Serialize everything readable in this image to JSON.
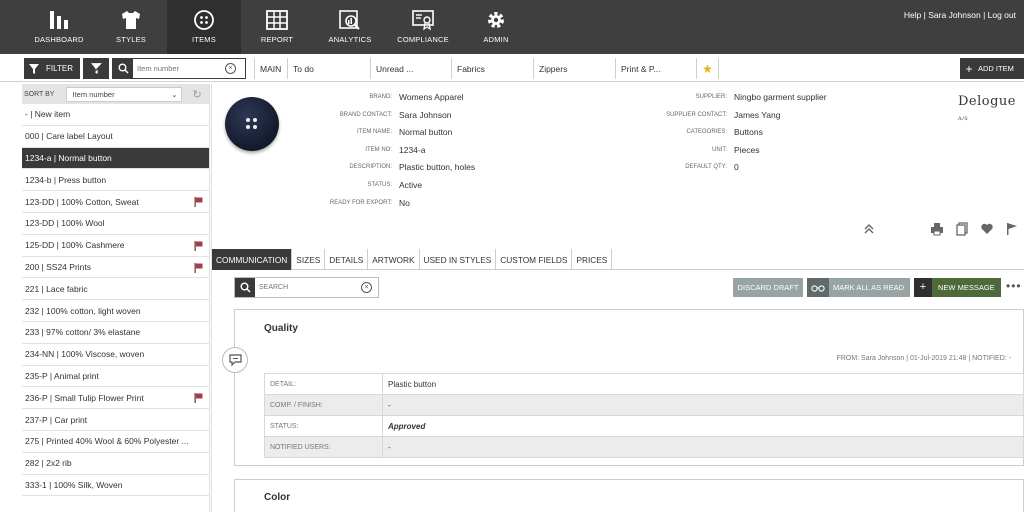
{
  "nav": {
    "items": [
      {
        "label": "DASHBOARD",
        "icon": "bar-chart-icon"
      },
      {
        "label": "STYLES",
        "icon": "shirt-icon"
      },
      {
        "label": "ITEMS",
        "icon": "button-icon"
      },
      {
        "label": "REPORT",
        "icon": "table-icon"
      },
      {
        "label": "ANALYTICS",
        "icon": "analytics-icon"
      },
      {
        "label": "COMPLIANCE",
        "icon": "certificate-icon"
      },
      {
        "label": "ADMIN",
        "icon": "gear-icon"
      }
    ],
    "active": "ITEMS",
    "user_links": "Help | Sara Johnson | Log out"
  },
  "toolbar": {
    "filter_label": "FILTER",
    "search_placeholder": "Item number",
    "tabs": [
      "MAIN",
      "To do",
      "Unread ...",
      "Fabrics",
      "Zippers",
      "Print & P..."
    ],
    "add_item_label": "ADD ITEM"
  },
  "sidebar": {
    "sort_by_label": "SORT BY",
    "sort_value": "Item number",
    "items": [
      {
        "label": "- | New item",
        "flag": false
      },
      {
        "label": "000 | Care label Layout",
        "flag": false
      },
      {
        "label": "1234-a | Normal button",
        "flag": false,
        "selected": true
      },
      {
        "label": "1234-b | Press button",
        "flag": false
      },
      {
        "label": "123-DD | 100% Cotton, Sweat",
        "flag": true
      },
      {
        "label": "123-DD | 100% Wool",
        "flag": false
      },
      {
        "label": "125-DD | 100% Cashmere",
        "flag": true
      },
      {
        "label": "200 | SS24 Prints",
        "flag": true
      },
      {
        "label": "221 | Lace fabric",
        "flag": false
      },
      {
        "label": "232 | 100% cotton, light woven",
        "flag": false
      },
      {
        "label": "233 | 97% cotton/ 3% elastane",
        "flag": false
      },
      {
        "label": "234-NN | 100% Viscose, woven",
        "flag": false
      },
      {
        "label": "235-P | Animal print",
        "flag": false
      },
      {
        "label": "236-P | Small Tulip Flower Print",
        "flag": true
      },
      {
        "label": "237-P | Car print",
        "flag": false
      },
      {
        "label": "275 | Printed 40% Wool & 60% Polyester ...",
        "flag": false
      },
      {
        "label": "282 | 2x2 rib",
        "flag": false
      },
      {
        "label": "333-1 | 100% Silk, Woven",
        "flag": false
      }
    ]
  },
  "item": {
    "left_fields": [
      {
        "label": "BRAND:",
        "value": "Womens Apparel"
      },
      {
        "label": "BRAND CONTACT:",
        "value": "Sara Johnson"
      },
      {
        "label": "ITEM NAME:",
        "value": "Normal button"
      },
      {
        "label": "ITEM NO:",
        "value": "1234-a"
      },
      {
        "label": "DESCRIPTION:",
        "value": "Plastic button, holes"
      },
      {
        "label": "STATUS:",
        "value": "Active"
      },
      {
        "label": "READY FOR EXPORT:",
        "value": "No"
      }
    ],
    "right_fields": [
      {
        "label": "SUPPLIER:",
        "value": "Ningbo garment supplier"
      },
      {
        "label": "SUPPLIER CONTACT:",
        "value": "James Yang"
      },
      {
        "label": "CATEGORIES:",
        "value": "Buttons"
      },
      {
        "label": "UNIT:",
        "value": "Pieces"
      },
      {
        "label": "DEFAULT QTY:",
        "value": "0"
      }
    ],
    "logo": "Delogue",
    "logo_suffix": "A/S"
  },
  "detail_tabs": [
    "COMMUNICATION",
    "SIZES",
    "DETAILS",
    "ARTWORK",
    "USED IN STYLES",
    "CUSTOM FIELDS",
    "PRICES"
  ],
  "communication": {
    "search_placeholder": "SEARCH",
    "discard_label": "DISCARD DRAFT",
    "mark_read_label": "MARK ALL AS READ",
    "new_message_label": "NEW MESSAGE",
    "messages": [
      {
        "title": "Quality",
        "from_line": "FROM: Sara Johnson | 01-Jul-2019 21:48 | NOTIFIED: -",
        "rows": [
          {
            "key": "DETAIL:",
            "value": "Plastic button"
          },
          {
            "key": "COMP. / FINISH:",
            "value": "-"
          },
          {
            "key": "STATUS:",
            "value": "Approved"
          },
          {
            "key": "NOTIFIED USERS:",
            "value": "-"
          }
        ]
      },
      {
        "title": "Color"
      }
    ]
  }
}
